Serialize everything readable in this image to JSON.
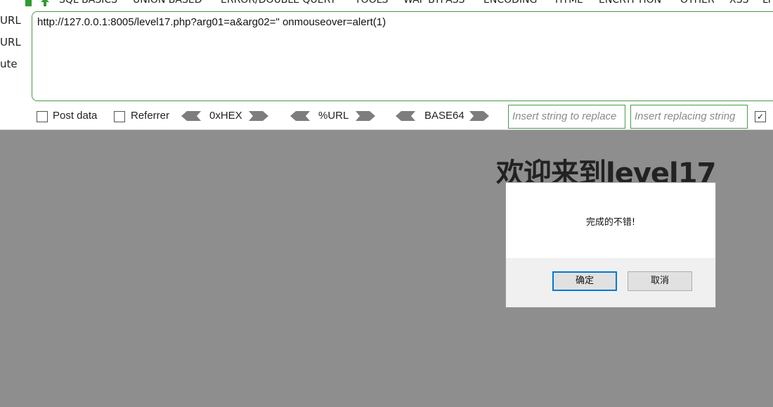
{
  "menu": {
    "items": [
      "SQL BASICS",
      "UNION BASED",
      "ERROR/DOUBLE QUERY",
      "TOOLS",
      "WAF BYPASS",
      "ENCODING",
      "HTML",
      "ENCRYPTION",
      "OTHER",
      "XSS",
      "LFI"
    ]
  },
  "side_labels": [
    "URL",
    "URL",
    "ute"
  ],
  "url_box": {
    "value": "http://127.0.0.1:8005/level17.php?arg01=a&arg02=\" onmouseover=alert(1)"
  },
  "options": {
    "post_data_label": "Post data",
    "referrer_label": "Referrer",
    "hex_label": "0xHEX",
    "url_label": "%URL",
    "base64_label": "BASE64",
    "replace_from_placeholder": "Insert string to replace",
    "replace_to_placeholder": "Insert replacing string"
  },
  "page": {
    "heading": "欢迎来到level17"
  },
  "dialog": {
    "message": "完成的不错!",
    "ok_label": "确定",
    "cancel_label": "取消"
  },
  "colors": {
    "accent_green": "#4a9a4a",
    "overlay_gray": "#8e8e8e",
    "focus_blue": "#0078d7"
  }
}
